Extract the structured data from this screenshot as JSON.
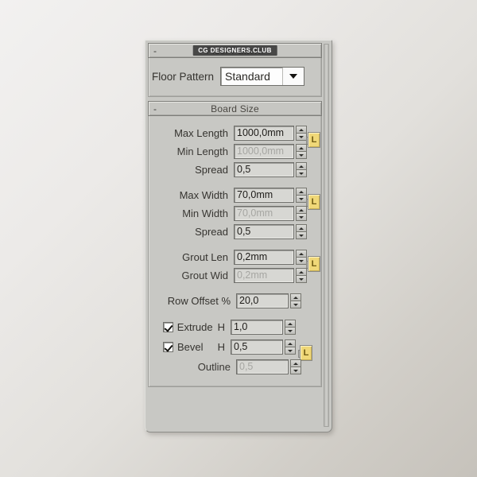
{
  "watermark": {
    "text": "CG DESIGNERS.CLUB"
  },
  "panel": {
    "rollouts": [
      {
        "id": "floor-pattern",
        "title": "Floor Pattern",
        "collapse_icon": "-",
        "dropdown": {
          "label": "Floor Pattern",
          "value": "Standard",
          "arrow_icon": "chevron-down-icon"
        }
      },
      {
        "id": "board-size",
        "title": "Board Size",
        "collapse_icon": "-"
      }
    ]
  },
  "board_size": {
    "rows": [
      {
        "label": "Max Length",
        "value": "1000,0mm",
        "disabled": false
      },
      {
        "label": "Min Length",
        "value": "1000,0mm",
        "disabled": true
      },
      {
        "label": "Spread",
        "value": "0,5",
        "disabled": false
      },
      {
        "label": "Max Width",
        "value": "70,0mm",
        "disabled": false
      },
      {
        "label": "Min Width",
        "value": "70,0mm",
        "disabled": true
      },
      {
        "label": "Spread",
        "value": "0,5",
        "disabled": false
      },
      {
        "label": "Grout Len",
        "value": "0,2mm",
        "disabled": false
      },
      {
        "label": "Grout Wid",
        "value": "0,2mm",
        "disabled": true
      },
      {
        "label": "Row Offset %",
        "value": "20,0",
        "disabled": false
      },
      {
        "label": "Extrude",
        "suffix": "H",
        "value": "1,0",
        "disabled": false,
        "checked": true
      },
      {
        "label": "Bevel",
        "suffix": "H",
        "value": "0,5",
        "disabled": false,
        "checked": true
      },
      {
        "label": "Outline",
        "value": "0,5",
        "disabled": true
      }
    ],
    "lock_label": "L"
  },
  "colors": {
    "panel_bg": "#c8c8c4",
    "field_bg": "#d7d7d3",
    "lock_yellow": "#f0d878",
    "text": "#35332f",
    "text_disabled": "#a6a6a2"
  }
}
